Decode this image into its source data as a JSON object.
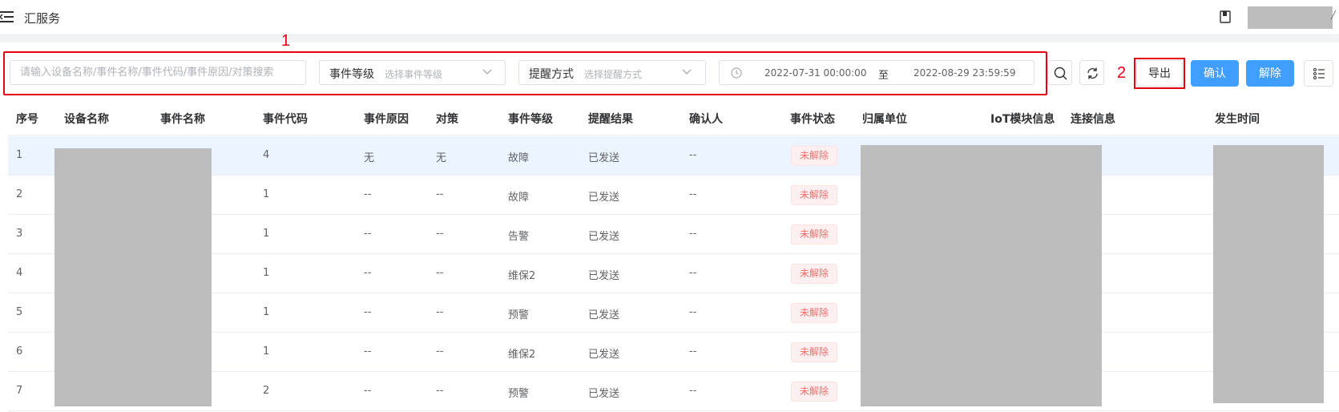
{
  "header": {
    "app_title": "汇服务",
    "menu_icon": "hamburger-menu-icon",
    "book_icon": "bookmark-icon"
  },
  "annotations": {
    "box1": "1",
    "box2": "2"
  },
  "filters": {
    "search_placeholder": "请输入设备名称/事件名称/事件代码/事件原因/对策搜索",
    "event_level_label": "事件等级",
    "event_level_placeholder": "选择事件等级",
    "remind_label": "提醒方式",
    "remind_placeholder": "选择提醒方式",
    "date_start": "2022-07-31 00:00:00",
    "date_separator": "至",
    "date_end": "2022-08-29 23:59:59"
  },
  "actions": {
    "export": "导出",
    "confirm": "确认",
    "release": "解除"
  },
  "table": {
    "columns": [
      "序号",
      "设备名称",
      "事件名称",
      "事件代码",
      "事件原因",
      "对策",
      "事件等级",
      "提醒结果",
      "确认人",
      "事件状态",
      "归属单位",
      "IoT模块信息",
      "连接信息",
      "发生时间"
    ],
    "rows": [
      {
        "no": "1",
        "code": "4",
        "reason": "无",
        "measure": "无",
        "level": "故障",
        "result": "已发送",
        "confirmer": "--",
        "status": "未解除"
      },
      {
        "no": "2",
        "code": "1",
        "reason": "--",
        "measure": "--",
        "level": "故障",
        "result": "已发送",
        "confirmer": "--",
        "status": "未解除"
      },
      {
        "no": "3",
        "code": "1",
        "reason": "--",
        "measure": "--",
        "level": "告警",
        "result": "已发送",
        "confirmer": "--",
        "status": "未解除"
      },
      {
        "no": "4",
        "code": "1",
        "reason": "--",
        "measure": "--",
        "level": "维保2",
        "result": "已发送",
        "confirmer": "--",
        "status": "未解除"
      },
      {
        "no": "5",
        "code": "1",
        "reason": "--",
        "measure": "--",
        "level": "预警",
        "result": "已发送",
        "confirmer": "--",
        "status": "未解除"
      },
      {
        "no": "6",
        "code": "1",
        "reason": "--",
        "measure": "--",
        "level": "维保2",
        "result": "已发送",
        "confirmer": "--",
        "status": "未解除"
      },
      {
        "no": "7",
        "code": "2",
        "reason": "--",
        "measure": "--",
        "level": "预警",
        "result": "已发送",
        "confirmer": "--",
        "status": "未解除"
      }
    ]
  },
  "colors": {
    "primary": "#409eff",
    "annotation_red": "#e60012",
    "danger_text": "#f56c6c",
    "redacted": "#bdbdbd"
  }
}
